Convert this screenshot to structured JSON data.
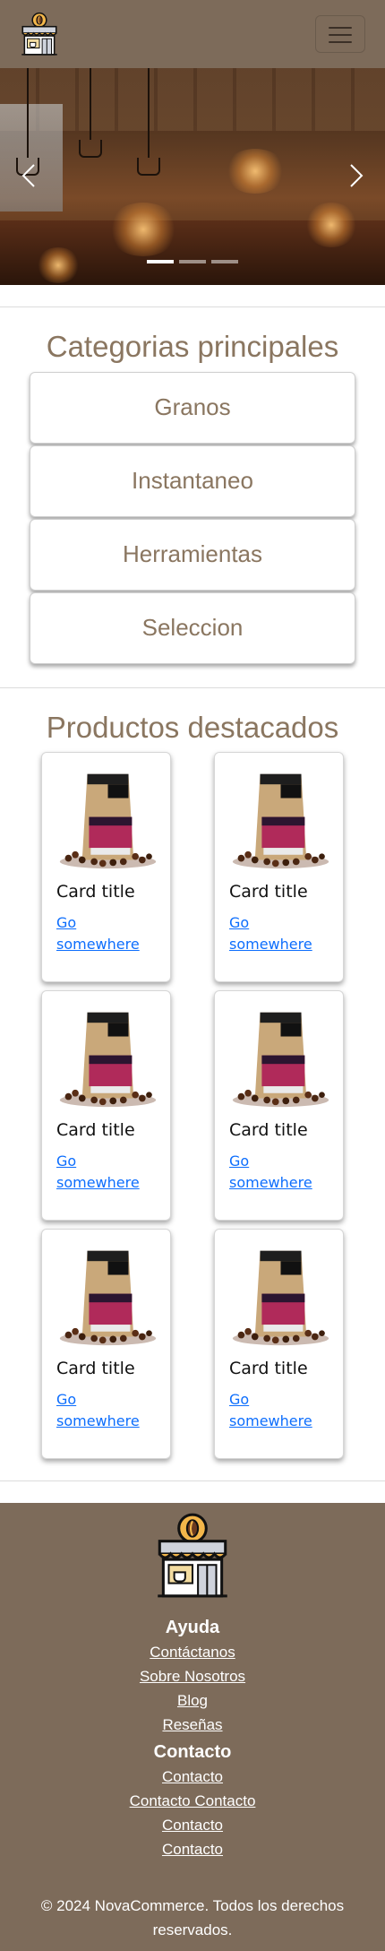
{
  "navbar": {
    "brand_icon": "coffee-shop-icon",
    "toggle_icon": "hamburger-icon"
  },
  "carousel": {
    "prev_icon": "chevron-left-icon",
    "next_icon": "chevron-right-icon",
    "slide_count": 3,
    "active_slide": 1
  },
  "categories": {
    "title": "Categorias principales",
    "items": [
      "Granos",
      "Instantaneo",
      "Herramientas",
      "Seleccion"
    ]
  },
  "products": {
    "title": "Productos destacados",
    "items": [
      {
        "title": "Card title",
        "link": "Go somewhere"
      },
      {
        "title": "Card title",
        "link": "Go somewhere"
      },
      {
        "title": "Card title",
        "link": "Go somewhere"
      },
      {
        "title": "Card title",
        "link": "Go somewhere"
      },
      {
        "title": "Card title",
        "link": "Go somewhere"
      },
      {
        "title": "Card title",
        "link": "Go somewhere"
      }
    ]
  },
  "footer": {
    "ayuda": {
      "title": "Ayuda",
      "links": [
        "Contáctanos",
        "Sobre Nosotros",
        "Blog",
        "Reseñas"
      ]
    },
    "contacto": {
      "title": "Contacto",
      "links": [
        "Contacto",
        "Contacto Contacto",
        "Contacto",
        "Contacto"
      ]
    },
    "copyright": "© 2024 NovaCommerce. Todos los derechos reservados."
  },
  "colors": {
    "brand": "#7d6b5a",
    "heading": "#8a7660",
    "link": "#0d6efd"
  }
}
